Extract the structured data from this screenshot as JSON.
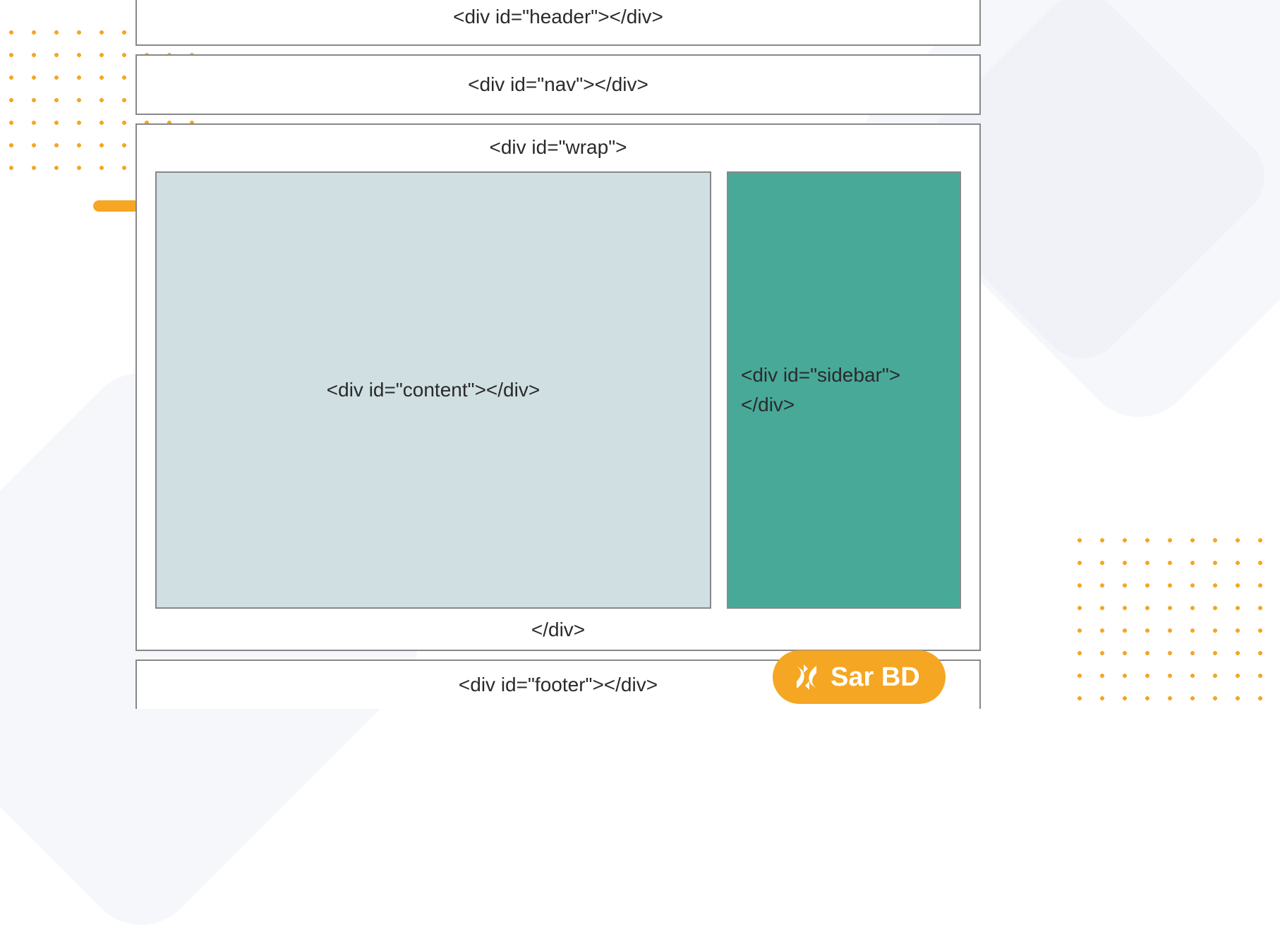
{
  "diagram": {
    "header_label": "<div id=\"header\"></div>",
    "nav_label": "<div id=\"nav\"></div>",
    "wrap_open_label": "<div id=\"wrap\">",
    "content_label": "<div id=\"content\"></div>",
    "sidebar_open": "<div id=\"sidebar\">",
    "sidebar_close": "</div>",
    "wrap_close_label": "</div>",
    "footer_label": "<div id=\"footer\"></div>"
  },
  "logo": {
    "text": "Sar BD"
  },
  "colors": {
    "content_bg": "#cfdfe2",
    "sidebar_bg": "#48a999",
    "accent": "#f5a623",
    "shape_bg": "#e8eaf6"
  }
}
